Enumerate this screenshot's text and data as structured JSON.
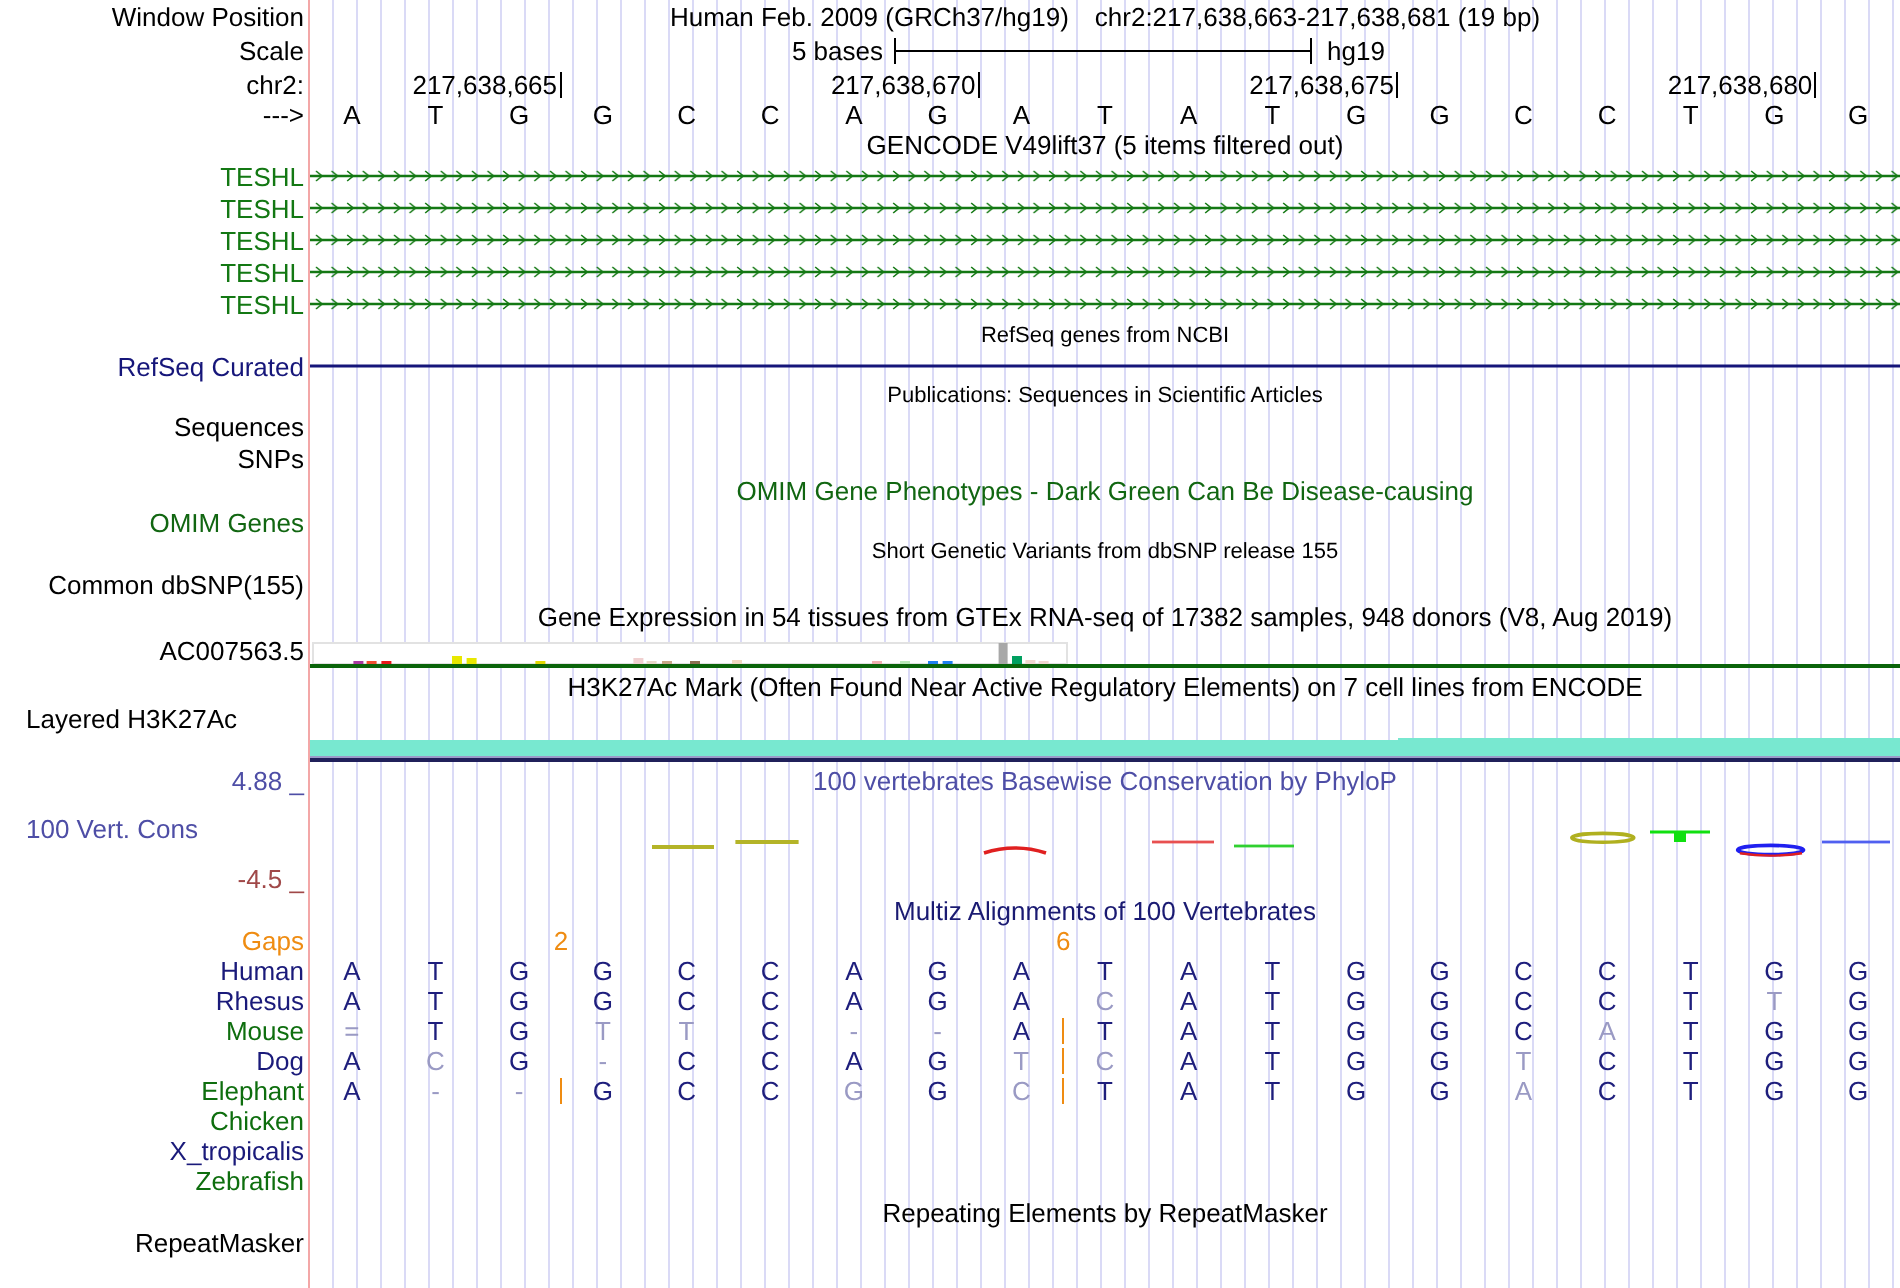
{
  "header": {
    "label": "Window Position",
    "assembly": "Human Feb. 2009 (GRCh37/hg19)",
    "position": "chr2:217,638,663-217,638,681 (19 bp)"
  },
  "scale": {
    "label": "Scale",
    "span": "5 bases",
    "assembly": "hg19"
  },
  "ruler": {
    "label": "chr2:",
    "strand": "--->",
    "bases": [
      {
        "base": "A"
      },
      {
        "base": "T"
      },
      {
        "base": "G",
        "coordinate": "217,638,665"
      },
      {
        "base": "G"
      },
      {
        "base": "C"
      },
      {
        "base": "C"
      },
      {
        "base": "A"
      },
      {
        "base": "G",
        "coordinate": "217,638,670"
      },
      {
        "base": "A"
      },
      {
        "base": "T"
      },
      {
        "base": "A"
      },
      {
        "base": "T"
      },
      {
        "base": "G",
        "coordinate": "217,638,675"
      },
      {
        "base": "G"
      },
      {
        "base": "C"
      },
      {
        "base": "C"
      },
      {
        "base": "T"
      },
      {
        "base": "G",
        "coordinate": "217,638,680"
      },
      {
        "base": "G"
      }
    ]
  },
  "tracks": [
    {
      "kind": "genes",
      "title": "GENCODE V49lift37 (5 items filtered out)",
      "color": "#137813",
      "items": [
        {
          "label": "TESHL"
        },
        {
          "label": "TESHL"
        },
        {
          "label": "TESHL"
        },
        {
          "label": "TESHL"
        },
        {
          "label": "TESHL"
        }
      ]
    },
    {
      "kind": "refseq",
      "title": "RefSeq genes from NCBI",
      "label": "RefSeq Curated",
      "color": "#16167a"
    },
    {
      "kind": "publications",
      "title": "Publications: Sequences in Scientific Articles",
      "labels": [
        "Sequences",
        "SNPs"
      ]
    },
    {
      "kind": "omim",
      "title": "OMIM Gene Phenotypes - Dark Green Can Be Disease-causing",
      "label": "OMIM Genes",
      "color": "#116611"
    },
    {
      "kind": "variants",
      "title": "Short Genetic Variants from dbSNP release 155",
      "label": "Common dbSNP(155)"
    },
    {
      "kind": "expression",
      "title": "Gene Expression in 54 tissues from GTEx RNA-seq of 17382 samples, 948 donors (V8, Aug 2019)",
      "label": "AC007563.5"
    },
    {
      "kind": "signal",
      "title": "H3K27Ac Mark (Often Found Near Active Regulatory Elements) on 7 cell lines from ENCODE",
      "label": "Layered H3K27Ac"
    },
    {
      "kind": "conservation",
      "title": "100 vertebrates Basewise Conservation by PhyloP",
      "label": "100 Vert. Cons",
      "color": "#4e4ea6",
      "max_label": "4.88 _",
      "min_label": "-4.5 _"
    },
    {
      "kind": "alignment",
      "title": "Multiz Alignments of 100 Vertebrates",
      "color": "#1a1a72",
      "gaps": {
        "label": "Gaps",
        "cells": [
          {
            "kind": "empty"
          },
          {
            "kind": "empty"
          },
          {
            "kind": "empty"
          },
          {
            "kind": "count",
            "text": "2"
          },
          {
            "kind": "empty"
          },
          {
            "kind": "empty"
          },
          {
            "kind": "empty"
          },
          {
            "kind": "empty"
          },
          {
            "kind": "empty"
          },
          {
            "kind": "empty"
          },
          {
            "kind": "count",
            "text": "6"
          },
          {
            "kind": "empty"
          },
          {
            "kind": "empty"
          },
          {
            "kind": "empty"
          },
          {
            "kind": "empty"
          },
          {
            "kind": "empty"
          },
          {
            "kind": "empty"
          },
          {
            "kind": "empty"
          },
          {
            "kind": "empty"
          },
          {
            "kind": "empty"
          },
          {
            "kind": "empty"
          }
        ]
      },
      "species": [
        {
          "name": "Human",
          "color": "#1a1a7a",
          "cells": [
            {
              "kind": "base",
              "text": "A",
              "match": true
            },
            {
              "kind": "base",
              "text": "T",
              "match": true
            },
            {
              "kind": "base",
              "text": "G",
              "match": true
            },
            {
              "kind": "base",
              "text": "G",
              "match": true
            },
            {
              "kind": "base",
              "text": "C",
              "match": true
            },
            {
              "kind": "base",
              "text": "C",
              "match": true
            },
            {
              "kind": "base",
              "text": "A",
              "match": true
            },
            {
              "kind": "base",
              "text": "G",
              "match": true
            },
            {
              "kind": "base",
              "text": "A",
              "match": true
            },
            {
              "kind": "base",
              "text": "T",
              "match": true
            },
            {
              "kind": "base",
              "text": "A",
              "match": true
            },
            {
              "kind": "base",
              "text": "T",
              "match": true
            },
            {
              "kind": "base",
              "text": "G",
              "match": true
            },
            {
              "kind": "base",
              "text": "G",
              "match": true
            },
            {
              "kind": "base",
              "text": "C",
              "match": true
            },
            {
              "kind": "base",
              "text": "C",
              "match": true
            },
            {
              "kind": "base",
              "text": "T",
              "match": true
            },
            {
              "kind": "base",
              "text": "G",
              "match": true
            },
            {
              "kind": "base",
              "text": "G",
              "match": true
            }
          ]
        },
        {
          "name": "Rhesus",
          "color": "#1a1a7a",
          "cells": [
            {
              "kind": "base",
              "text": "A",
              "match": true
            },
            {
              "kind": "base",
              "text": "T",
              "match": true
            },
            {
              "kind": "base",
              "text": "G",
              "match": true
            },
            {
              "kind": "base",
              "text": "G",
              "match": true
            },
            {
              "kind": "base",
              "text": "C",
              "match": true
            },
            {
              "kind": "base",
              "text": "C",
              "match": true
            },
            {
              "kind": "base",
              "text": "A",
              "match": true
            },
            {
              "kind": "base",
              "text": "G",
              "match": true
            },
            {
              "kind": "base",
              "text": "A",
              "match": true
            },
            {
              "kind": "base",
              "text": "C",
              "match": false
            },
            {
              "kind": "base",
              "text": "A",
              "match": true
            },
            {
              "kind": "base",
              "text": "T",
              "match": true
            },
            {
              "kind": "base",
              "text": "G",
              "match": true
            },
            {
              "kind": "base",
              "text": "G",
              "match": true
            },
            {
              "kind": "base",
              "text": "C",
              "match": true
            },
            {
              "kind": "base",
              "text": "C",
              "match": true
            },
            {
              "kind": "base",
              "text": "T",
              "match": true
            },
            {
              "kind": "base",
              "text": "T",
              "match": false
            },
            {
              "kind": "base",
              "text": "G",
              "match": true
            }
          ]
        },
        {
          "name": "Mouse",
          "color": "#0e6e0e",
          "cells": [
            {
              "kind": "base",
              "text": "=",
              "match": false
            },
            {
              "kind": "base",
              "text": "T",
              "match": true
            },
            {
              "kind": "base",
              "text": "G",
              "match": true
            },
            {
              "kind": "base",
              "text": "T",
              "match": false
            },
            {
              "kind": "base",
              "text": "T",
              "match": false
            },
            {
              "kind": "base",
              "text": "C",
              "match": true
            },
            {
              "kind": "base",
              "text": "-",
              "match": false
            },
            {
              "kind": "base",
              "text": "-",
              "match": false
            },
            {
              "kind": "base",
              "text": "A",
              "match": true
            },
            {
              "kind": "insert"
            },
            {
              "kind": "base",
              "text": "T",
              "match": true
            },
            {
              "kind": "base",
              "text": "A",
              "match": true
            },
            {
              "kind": "base",
              "text": "T",
              "match": true
            },
            {
              "kind": "base",
              "text": "G",
              "match": true
            },
            {
              "kind": "base",
              "text": "G",
              "match": true
            },
            {
              "kind": "base",
              "text": "C",
              "match": true
            },
            {
              "kind": "base",
              "text": "A",
              "match": false
            },
            {
              "kind": "base",
              "text": "T",
              "match": true
            },
            {
              "kind": "base",
              "text": "G",
              "match": true
            },
            {
              "kind": "base",
              "text": "G",
              "match": true
            }
          ]
        },
        {
          "name": "Dog",
          "color": "#1a1a7a",
          "cells": [
            {
              "kind": "base",
              "text": "A",
              "match": true
            },
            {
              "kind": "base",
              "text": "C",
              "match": false
            },
            {
              "kind": "base",
              "text": "G",
              "match": true
            },
            {
              "kind": "base",
              "text": "-",
              "match": false
            },
            {
              "kind": "base",
              "text": "C",
              "match": true
            },
            {
              "kind": "base",
              "text": "C",
              "match": true
            },
            {
              "kind": "base",
              "text": "A",
              "match": true
            },
            {
              "kind": "base",
              "text": "G",
              "match": true
            },
            {
              "kind": "base",
              "text": "T",
              "match": false
            },
            {
              "kind": "insert"
            },
            {
              "kind": "base",
              "text": "C",
              "match": false
            },
            {
              "kind": "base",
              "text": "A",
              "match": true
            },
            {
              "kind": "base",
              "text": "T",
              "match": true
            },
            {
              "kind": "base",
              "text": "G",
              "match": true
            },
            {
              "kind": "base",
              "text": "G",
              "match": true
            },
            {
              "kind": "base",
              "text": "T",
              "match": false
            },
            {
              "kind": "base",
              "text": "C",
              "match": true
            },
            {
              "kind": "base",
              "text": "T",
              "match": true
            },
            {
              "kind": "base",
              "text": "G",
              "match": true
            },
            {
              "kind": "base",
              "text": "G",
              "match": true
            }
          ]
        },
        {
          "name": "Elephant",
          "color": "#0e6e0e",
          "cells": [
            {
              "kind": "base",
              "text": "A",
              "match": true
            },
            {
              "kind": "base",
              "text": "-",
              "match": false
            },
            {
              "kind": "base",
              "text": "-",
              "match": false
            },
            {
              "kind": "insert"
            },
            {
              "kind": "base",
              "text": "G",
              "match": true
            },
            {
              "kind": "base",
              "text": "C",
              "match": true
            },
            {
              "kind": "base",
              "text": "C",
              "match": true
            },
            {
              "kind": "base",
              "text": "G",
              "match": false
            },
            {
              "kind": "base",
              "text": "G",
              "match": true
            },
            {
              "kind": "base",
              "text": "C",
              "match": false
            },
            {
              "kind": "insert"
            },
            {
              "kind": "base",
              "text": "T",
              "match": true
            },
            {
              "kind": "base",
              "text": "A",
              "match": true
            },
            {
              "kind": "base",
              "text": "T",
              "match": true
            },
            {
              "kind": "base",
              "text": "G",
              "match": true
            },
            {
              "kind": "base",
              "text": "G",
              "match": true
            },
            {
              "kind": "base",
              "text": "A",
              "match": false
            },
            {
              "kind": "base",
              "text": "C",
              "match": true
            },
            {
              "kind": "base",
              "text": "T",
              "match": true
            },
            {
              "kind": "base",
              "text": "G",
              "match": true
            },
            {
              "kind": "base",
              "text": "G",
              "match": true
            }
          ]
        },
        {
          "name": "Chicken",
          "color": "#0e6e0e"
        },
        {
          "name": "X_tropicalis",
          "color": "#1a1a7a"
        },
        {
          "name": "Zebrafish",
          "color": "#0e6e0e"
        }
      ]
    },
    {
      "kind": "repeats",
      "title": "Repeating Elements by RepeatMasker",
      "label": "RepeatMasker"
    }
  ]
}
